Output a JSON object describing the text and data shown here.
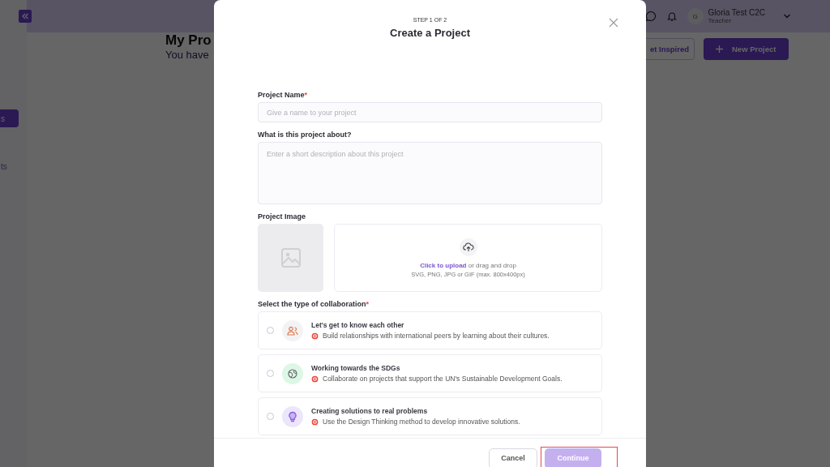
{
  "background_page": {
    "sidebar_items": [
      {
        "label": "s",
        "selected": true
      },
      {
        "label": "ts",
        "selected": false
      }
    ],
    "heading": "My Pro",
    "subheading": "You have",
    "buttons": [
      {
        "label": "et Inspired",
        "kind": "outline"
      },
      {
        "label": "New Project",
        "kind": "primary"
      }
    ],
    "user": {
      "initial": "G",
      "name": "Gloria Test C2C",
      "role": "Teacher"
    }
  },
  "modal": {
    "step": "STEP 1 OF 2",
    "title": "Create a Project",
    "fields": [
      {
        "label": "Project Name",
        "required_mark": "*",
        "placeholder": "Give a name to your project",
        "kind": "input"
      },
      {
        "label": "What is this project about?",
        "placeholder": "Enter a short description about this project",
        "kind": "textarea"
      }
    ],
    "image": {
      "label": "Project Image",
      "upload_link": "Click to upload",
      "upload_text": "or drag and drop",
      "upload_hint": "SVG, PNG, JPG or GIF (max. 800x400px)"
    },
    "collaboration": {
      "label": "Select the type of collaboration",
      "required_mark": "*",
      "options": [
        {
          "title": "Let's get to know each other",
          "description": "Build relationships with international peers by learning about their cultures.",
          "kind": "people",
          "selected": false
        },
        {
          "title": "Working towards the SDGs",
          "description": "Collaborate on projects that support the UN's Sustainable Development Goals.",
          "kind": "globe",
          "selected": false
        },
        {
          "title": "Creating solutions to real problems",
          "description": "Use the Design Thinking method to develop innovative solutions.",
          "kind": "bulb",
          "selected": false
        }
      ]
    },
    "footer": {
      "cancel": "Cancel",
      "continue": {
        "label": "Continue",
        "disabled": true,
        "highlighted": true
      }
    }
  }
}
